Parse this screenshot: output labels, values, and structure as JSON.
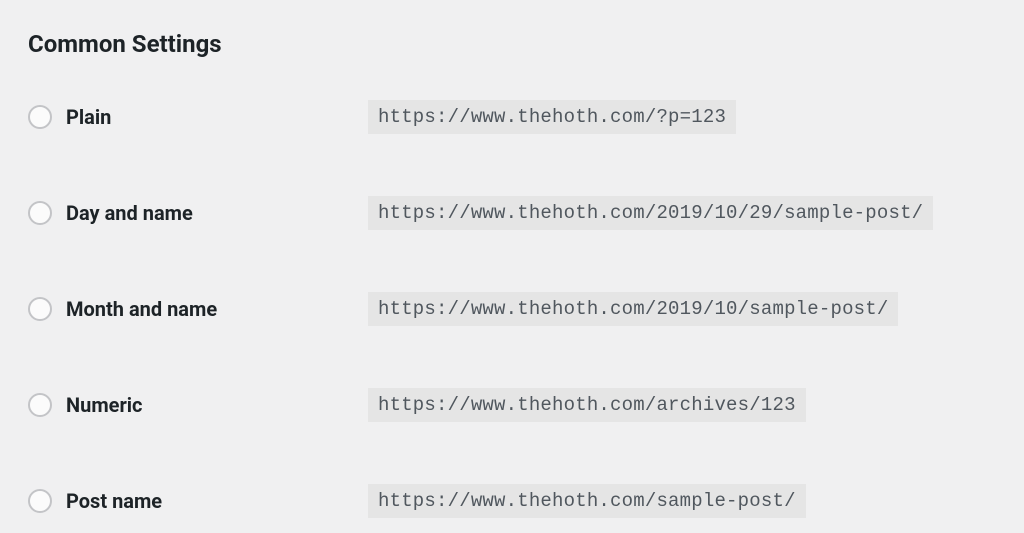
{
  "section": {
    "title": "Common Settings"
  },
  "permalink_options": [
    {
      "id": "plain",
      "label": "Plain",
      "example": "https://www.thehoth.com/?p=123",
      "selected": false
    },
    {
      "id": "day-name",
      "label": "Day and name",
      "example": "https://www.thehoth.com/2019/10/29/sample-post/",
      "selected": false
    },
    {
      "id": "month-name",
      "label": "Month and name",
      "example": "https://www.thehoth.com/2019/10/sample-post/",
      "selected": false
    },
    {
      "id": "numeric",
      "label": "Numeric",
      "example": "https://www.thehoth.com/archives/123",
      "selected": false
    },
    {
      "id": "post-name",
      "label": "Post name",
      "example": "https://www.thehoth.com/sample-post/",
      "selected": false
    }
  ]
}
